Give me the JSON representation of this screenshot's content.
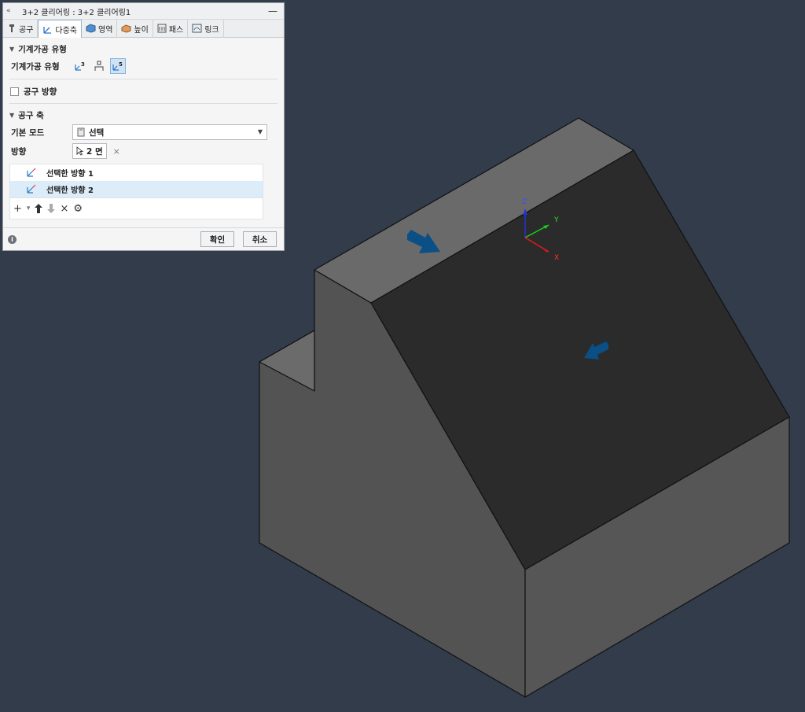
{
  "panel": {
    "title": "3+2 클리어링 : 3+2 클리어링1",
    "collapse_glyph": "«",
    "minimize_glyph": "—",
    "tabs": [
      {
        "label": "공구",
        "icon": "tool-icon"
      },
      {
        "label": "다중축",
        "icon": "multi-axis-icon",
        "active": true
      },
      {
        "label": "영역",
        "icon": "geometry-icon"
      },
      {
        "label": "높이",
        "icon": "height-icon"
      },
      {
        "label": "패스",
        "icon": "passes-icon"
      },
      {
        "label": "링크",
        "icon": "linking-icon"
      }
    ],
    "machining_type_section": {
      "header": "기계가공 유형",
      "row_label": "기계가공 유형",
      "options": [
        {
          "icon": "three-axis-icon",
          "text": "3"
        },
        {
          "icon": "tool-orientation-icon",
          "text": ""
        },
        {
          "icon": "five-axis-icon",
          "text": "5",
          "selected": true
        }
      ]
    },
    "tool_orientation": {
      "label": "공구 방향",
      "checked": false
    },
    "tool_axis_section": {
      "header": "공구 축",
      "mode_label": "기본 모드",
      "mode_value": "선택",
      "direction_label": "방향",
      "direction_value": "2 면",
      "clear_glyph": "×",
      "list": [
        {
          "label": "선택한 방향 1",
          "selected": false
        },
        {
          "label": "선택한 방향 2",
          "selected": true
        }
      ]
    },
    "toolbar": {
      "add": "+",
      "dropdown": "▾",
      "up": "🡅",
      "down": "🡇",
      "delete": "×",
      "settings": "⚙"
    },
    "footer": {
      "info": "i",
      "ok_label": "확인",
      "cancel_label": "취소"
    }
  },
  "viewport": {
    "triad": {
      "x_label": "X",
      "y_label": "Y",
      "z_label": "Z"
    },
    "colors": {
      "background": "#323c4a",
      "face_left": "#535353",
      "face_top": "#696969",
      "face_slope": "#2b2b2b",
      "arrow": "#0a4f86"
    }
  }
}
